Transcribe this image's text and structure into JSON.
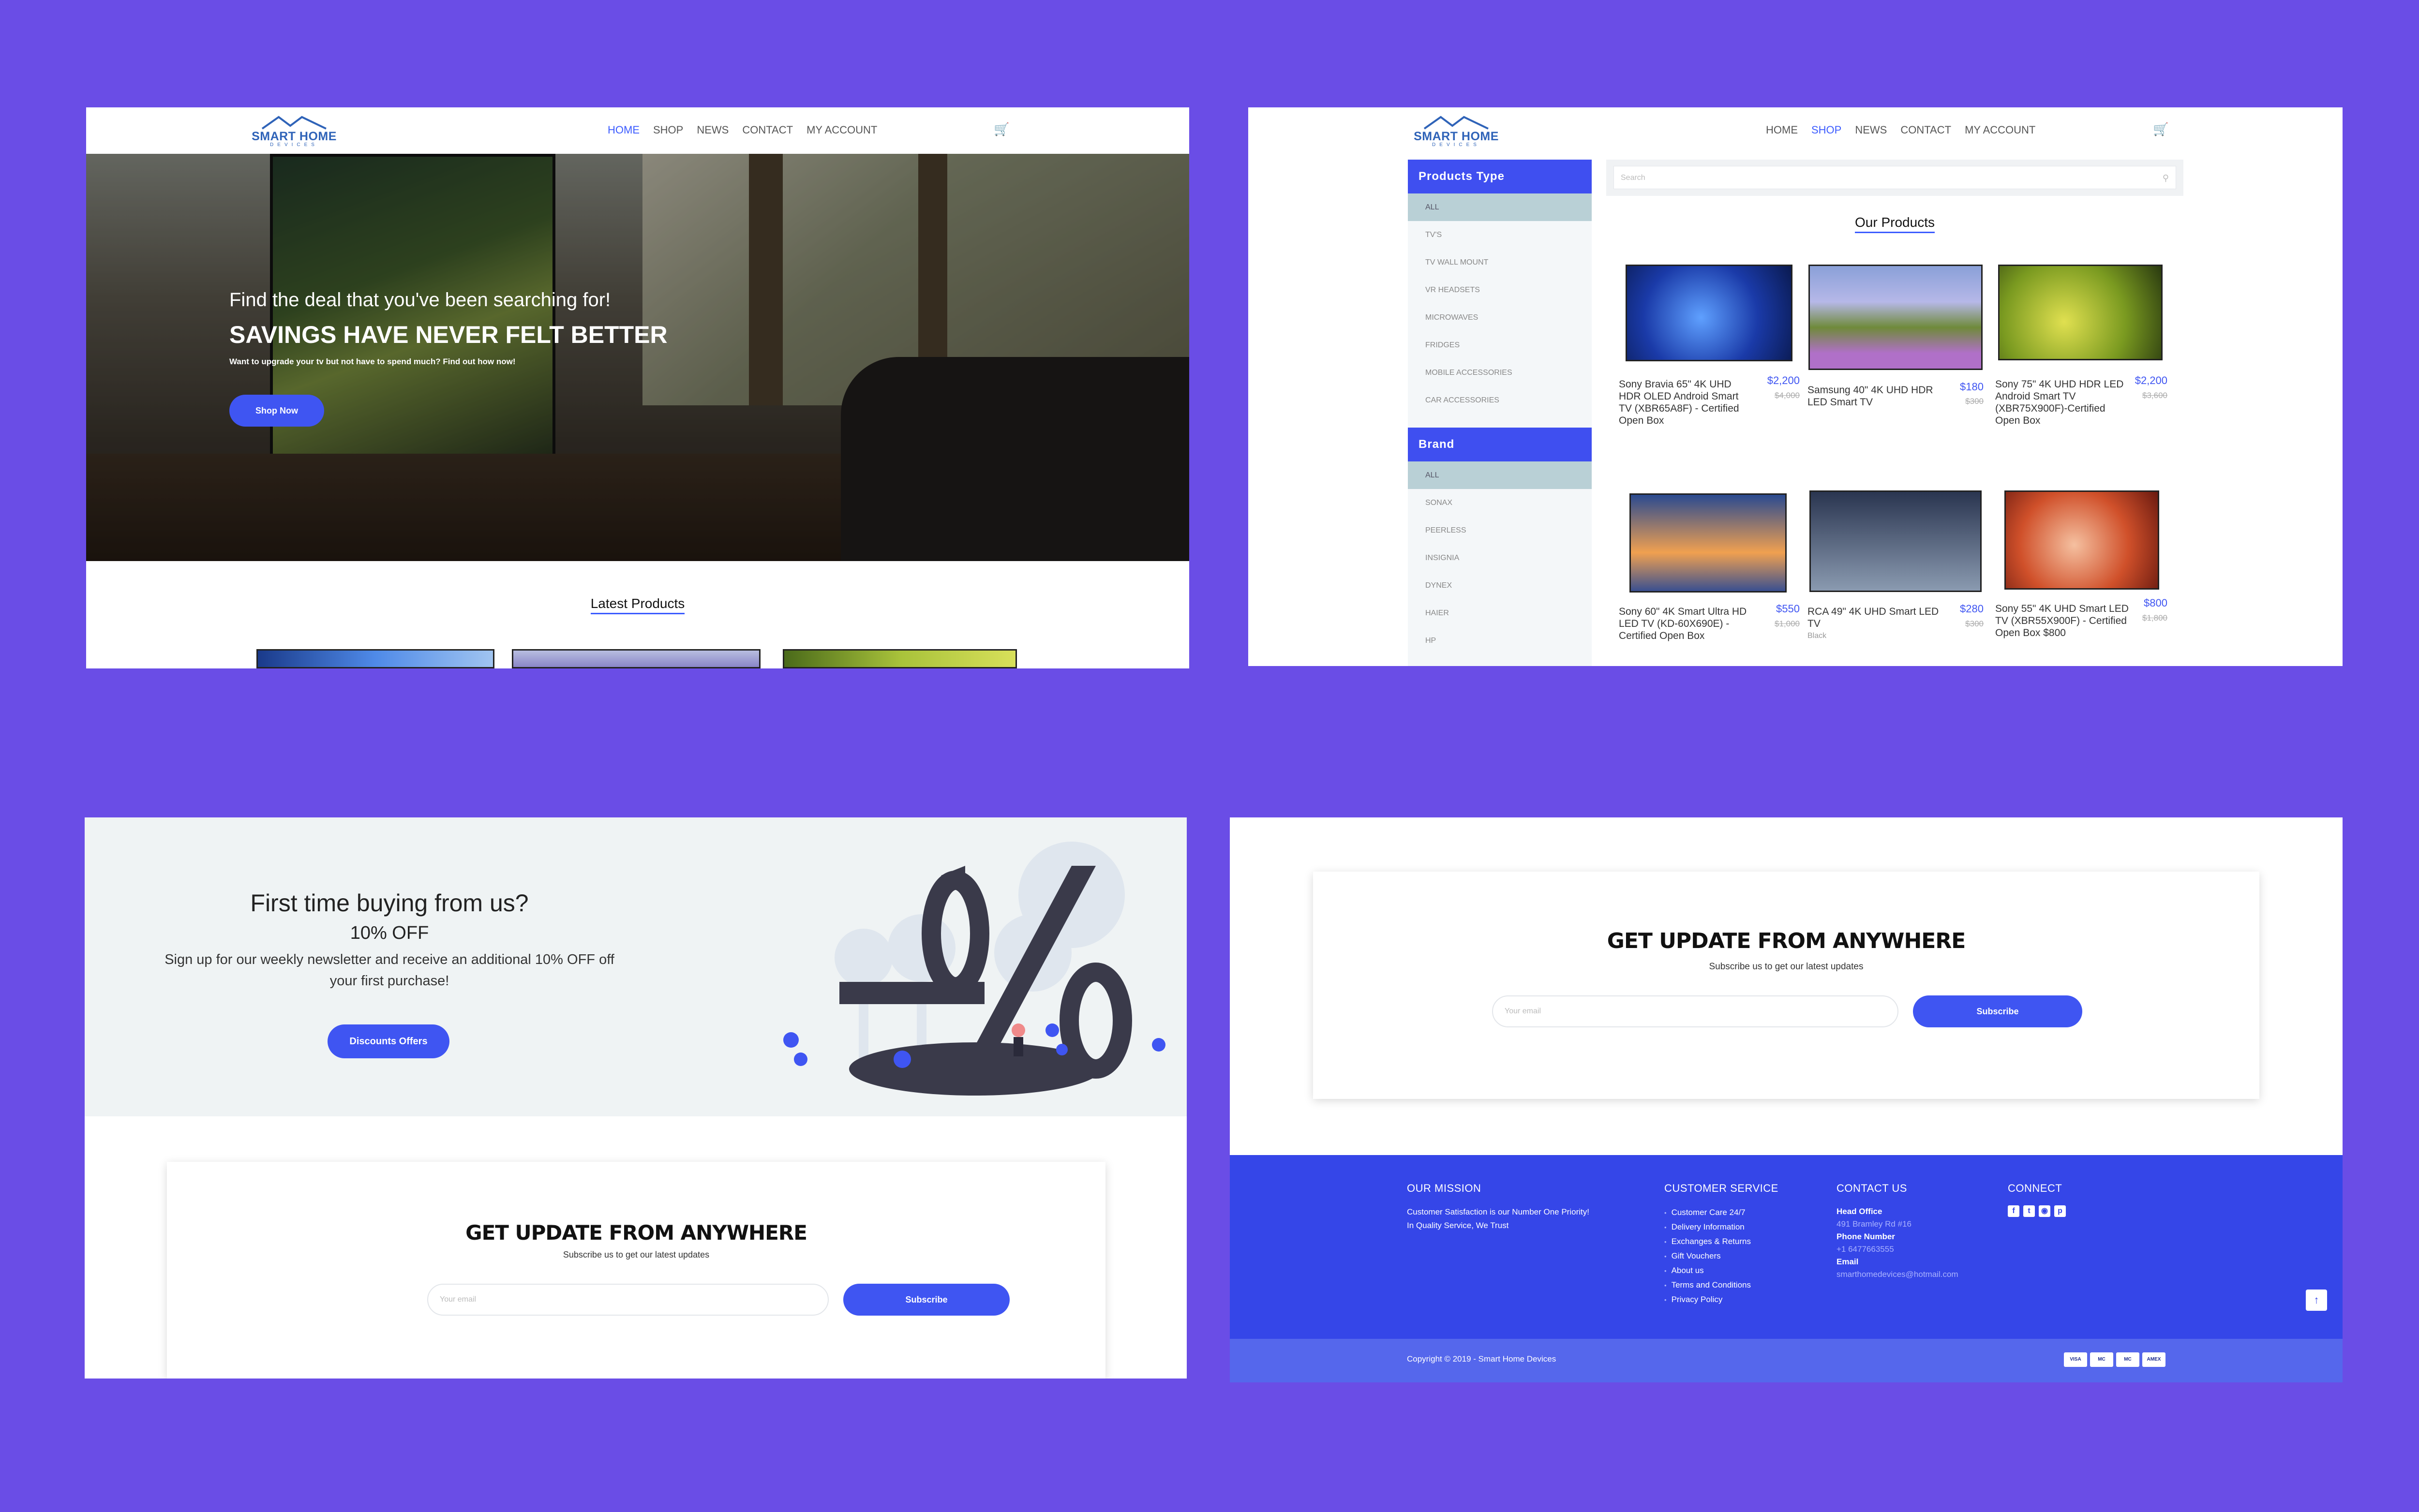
{
  "header": {
    "brand": "SMART HOME",
    "brand_sub": "DEVICES",
    "nav": [
      "HOME",
      "SHOP",
      "NEWS",
      "CONTACT",
      "MY ACCOUNT"
    ],
    "cart_icon": "shopping-cart-icon"
  },
  "home": {
    "hero_tagline": "Find the deal that you've been searching for!",
    "hero_title": "SAVINGS HAVE NEVER FELT BETTER",
    "hero_subtitle": "Want to upgrade your tv but not have to spend much? Find out how now!",
    "hero_button": "Shop Now",
    "latest_title": "Latest Products"
  },
  "shop": {
    "types_title": "Products Type",
    "types": [
      "ALL",
      "TV'S",
      "TV WALL MOUNT",
      "VR HEADSETS",
      "MICROWAVES",
      "FRIDGES",
      "MOBILE ACCESSORIES",
      "CAR ACCESSORIES"
    ],
    "brand_title": "Brand",
    "brands": [
      "ALL",
      "SONAX",
      "PEERLESS",
      "INSIGNIA",
      "DYNEX",
      "HAIER",
      "HP"
    ],
    "search_placeholder": "Search",
    "products_title": "Our Products",
    "products": [
      {
        "name": "Sony Bravia 65\" 4K UHD HDR OLED Android Smart TV (XBR65A8F) - Certified Open Box",
        "price": "$2,200",
        "old": "$4,000",
        "note": ""
      },
      {
        "name": "Samsung 40\" 4K UHD HDR LED Smart TV",
        "price": "$180",
        "old": "$300",
        "note": ""
      },
      {
        "name": "Sony 75\" 4K UHD HDR LED Android Smart TV (XBR75X900F)-Certified Open Box",
        "price": "$2,200",
        "old": "$3,600",
        "note": ""
      },
      {
        "name": "Sony 60\" 4K Smart Ultra HD LED TV (KD-60X690E) - Certified Open Box",
        "price": "$550",
        "old": "$1,000",
        "note": ""
      },
      {
        "name": "RCA 49\" 4K UHD Smart LED TV",
        "price": "$280",
        "old": "$300",
        "note": "Black"
      },
      {
        "name": "Sony 55\" 4K UHD Smart LED TV (XBR55X900F) - Certified Open Box $800",
        "price": "$800",
        "old": "$1,800",
        "note": ""
      }
    ]
  },
  "promo": {
    "title": "First time buying from us?",
    "off": "10% OFF",
    "text": "Sign up for our weekly newsletter and receive an additional 10% OFF off your first purchase!",
    "button": "Discounts Offers"
  },
  "newsletter": {
    "title": "GET UPDATE FROM ANYWHERE",
    "subtitle": "Subscribe us to get our latest updates",
    "placeholder": "Your email",
    "button": "Subscribe"
  },
  "footer": {
    "mission_title": "OUR MISSION",
    "mission_text": "Customer Satisfaction is our Number One Priority!",
    "mission_text2": "In Quality Service, We Trust",
    "service_title": "CUSTOMER SERVICE",
    "service_links": [
      "Customer Care 24/7",
      "Delivery Information",
      "Exchanges & Returns",
      "Gift Vouchers",
      "About us",
      "Terms and Conditions",
      "Privacy Policy"
    ],
    "contact_title": "CONTACT US",
    "head_office_label": "Head Office",
    "head_office": "491 Bramley Rd #16",
    "phone_label": "Phone Number",
    "phone": "+1 6477663555",
    "email_label": "Email",
    "email": "smarthomedevices@hotmail.com",
    "connect_title": "CONNECT",
    "copyright": "Copyright © 2019 - Smart Home Devices",
    "payments": [
      "VISA",
      "MC",
      "MC",
      "AMEX"
    ]
  },
  "colors": {
    "accent": "#3f55f2",
    "background": "#6a4de6",
    "footer": "#3546e8"
  }
}
